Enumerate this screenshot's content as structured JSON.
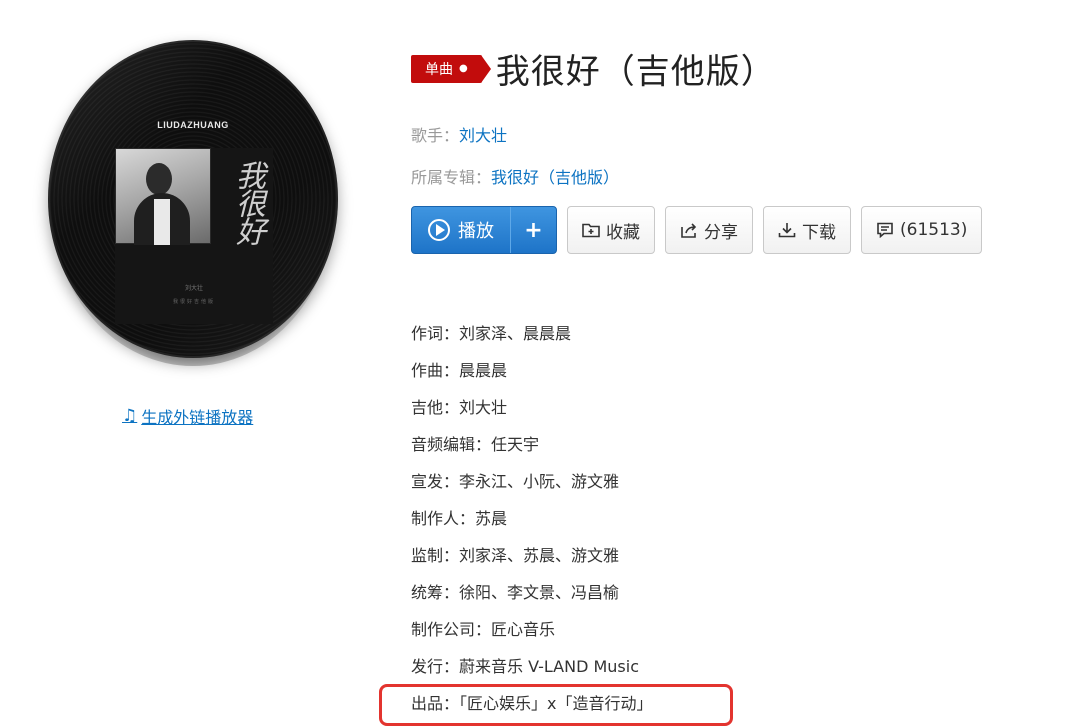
{
  "cover": {
    "brand_text": "LIUDAZHUANG",
    "art_title": "我很好",
    "art_small_text": "刘大壮",
    "art_small_text2": "我很好吉他版"
  },
  "external_player_link": "生成外链播放器",
  "song": {
    "badge": "单曲",
    "title": "我很好（吉他版）"
  },
  "meta": {
    "singer_label": "歌手：",
    "singer": "刘大壮",
    "album_label": "所属专辑：",
    "album": "我很好（吉他版）"
  },
  "actions": {
    "play": "播放",
    "add": "+",
    "collect": "收藏",
    "share": "分享",
    "download": "下载",
    "comments": "(61513)"
  },
  "credits": [
    "作词：刘家泽、晨晨晨",
    "作曲：晨晨晨",
    "吉他：刘大壮",
    "音频编辑：任天宇",
    "宣发：李永江、小阮、游文雅",
    "制作人：苏晨",
    "监制：刘家泽、苏晨、游文雅",
    "统筹：徐阳、李文景、冯昌榆",
    "制作公司：匠心音乐",
    "发行：蔚来音乐 V-LAND Music",
    "出品：「匠心娱乐」x「造音行动」"
  ],
  "colors": {
    "accent_red": "#c20c0c",
    "link_blue": "#0c73c2",
    "play_blue": "#2a83d5",
    "highlight_red": "#e3342f"
  }
}
